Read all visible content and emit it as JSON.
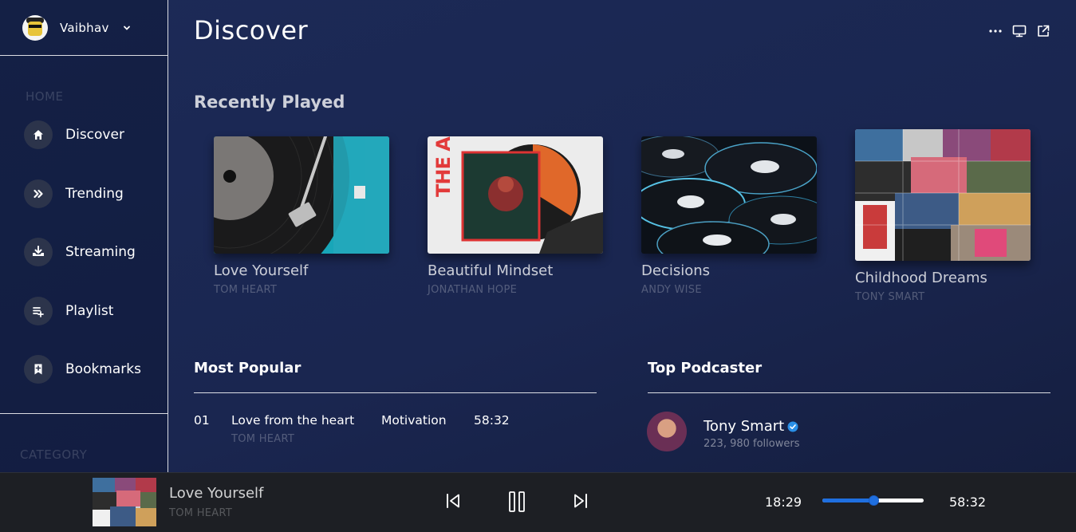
{
  "profile": {
    "name": "Vaibhav"
  },
  "sidebar": {
    "home_label": "HOME",
    "category_label": "CATEGORY",
    "items": [
      {
        "label": "Discover",
        "icon": "home-icon"
      },
      {
        "label": "Trending",
        "icon": "double-chevron-right-icon"
      },
      {
        "label": "Streaming",
        "icon": "download-tray-icon"
      },
      {
        "label": "Playlist",
        "icon": "playlist-add-icon"
      },
      {
        "label": "Bookmarks",
        "icon": "bookmark-add-icon"
      }
    ]
  },
  "header": {
    "title": "Discover"
  },
  "recently_played": {
    "title": "Recently Played",
    "cards": [
      {
        "title": "Love Yourself",
        "artist": "TOM HEART"
      },
      {
        "title": "Beautiful Mindset",
        "artist": "JONATHAN HOPE",
        "album_text": "THE ACT"
      },
      {
        "title": "Decisions",
        "artist": "ANDY WISE"
      },
      {
        "title": "Childhood Dreams",
        "artist": "TONY SMART"
      }
    ]
  },
  "most_popular": {
    "title": "Most Popular",
    "rows": [
      {
        "rank": "01",
        "title": "Love from the heart",
        "genre": "Motivation",
        "duration": "58:32",
        "artist": "TOM HEART"
      }
    ]
  },
  "top_podcaster": {
    "title": "Top Podcaster",
    "items": [
      {
        "name": "Tony Smart",
        "followers": "223, 980 followers",
        "verified": true
      }
    ]
  },
  "player": {
    "title": "Love Yourself",
    "artist": "TOM HEART",
    "elapsed": "18:29",
    "total": "58:32",
    "progress": 0.5
  },
  "colors": {
    "background": "#1c2a57",
    "accent": "#1f6fe0",
    "player_bar": "#1d1f24",
    "nav_icon_bg": "#2c344b",
    "verified": "#2a8fe6"
  }
}
